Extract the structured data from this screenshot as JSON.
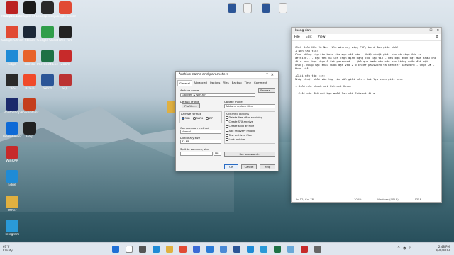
{
  "desktop_icons": [
    {
      "label": "Recycle Bin",
      "color": "#3d6fa8"
    },
    {
      "label": "League of Legends",
      "color": "#1a1a1a"
    },
    {
      "label": "Kaspersky",
      "color": "#2a2a2a"
    },
    {
      "label": "Google Chrome",
      "color": "#e14a34"
    },
    {
      "label": "Google Chrome",
      "color": "#e14a34"
    },
    {
      "label": "Steam",
      "color": "#1b2838"
    },
    {
      "label": "Google Sheets",
      "color": "#2f9e4a"
    },
    {
      "label": "Wild Rift",
      "color": "#222"
    },
    {
      "label": "Edge",
      "color": "#1f8bd6"
    },
    {
      "label": "Firefox",
      "color": "#e8632a"
    },
    {
      "label": "Microsoft Excel",
      "color": "#1e7145"
    },
    {
      "label": "Zoom",
      "color": "#c72a2a"
    },
    {
      "label": "OBS",
      "color": "#2a2a2a"
    },
    {
      "label": "Brave",
      "color": "#f04a2a"
    },
    {
      "label": "Word",
      "color": "#2b5597"
    },
    {
      "label": "SQL",
      "color": "#b33"
    },
    {
      "label": "Photoshop",
      "color": "#1b2a6b"
    },
    {
      "label": "PowerPoint",
      "color": "#c43e1c"
    },
    {
      "label": "TeamViewer",
      "color": "#0e6ad6"
    },
    {
      "label": "Help",
      "color": "#222"
    },
    {
      "label": "WinRAR",
      "color": "#c72a2a"
    },
    {
      "label": "Edge",
      "color": "#1f8bd6"
    },
    {
      "label": "Other",
      "color": "#e0b040"
    },
    {
      "label": "Telegram",
      "color": "#2a9ad8"
    },
    {
      "label": "NF",
      "color": "#e0b040"
    },
    {
      "label": "Mobile Gamer",
      "color": "#b22"
    }
  ],
  "top_files": [
    {
      "label": "Word doc",
      "color": "#2b5597"
    },
    {
      "label": "Image file",
      "color": "#f2f2f2"
    },
    {
      "label": "Word doc",
      "color": "#2b5597"
    },
    {
      "label": "Text file",
      "color": "#f2f2f2"
    }
  ],
  "winrar": {
    "title": "Archive name and parameters",
    "tabs": [
      "General",
      "Advanced",
      "Options",
      "Files",
      "Backup",
      "Time",
      "Comment"
    ],
    "archive_name_label": "Archive name",
    "archive_name_value": "Giai Nen & Nen.rar",
    "browse_label": "Browse...",
    "default_profile_label": "Default Profile",
    "profiles_label": "Profiles...",
    "update_mode_label": "Update mode",
    "update_mode_value": "Add and replace files",
    "archive_format_label": "Archive format",
    "formats": [
      "RAR",
      "RAR4",
      "ZIP"
    ],
    "compression_label": "Compression method",
    "compression_value": "Normal",
    "dict_label": "Dictionary size",
    "dict_value": "32 MB",
    "split_label": "Split to volumes, size",
    "split_unit": "MB",
    "options_label": "Archiving options",
    "options": [
      {
        "label": "Delete files after archiving",
        "on": false
      },
      {
        "label": "Create SFX archive",
        "on": false
      },
      {
        "label": "Create solid archive",
        "on": false
      },
      {
        "label": "Add recovery record",
        "on": false
      },
      {
        "label": "Test archived files",
        "on": false
      },
      {
        "label": "Lock archive",
        "on": false
      }
    ],
    "set_password_label": "Set password...",
    "ok_label": "OK",
    "cancel_label": "Cancel",
    "help_label": "Help"
  },
  "notepad": {
    "title": "Huong dan",
    "menu": [
      "File",
      "Edit",
      "View"
    ],
    "lines": [
      "Cách Giải Nén Và Nén file winrar, zip, PDF, Word đơn giản nhất",
      "+ Nén tập tin:",
      "Chọn những tập tin hoặc thư mục cần nén - Nhấp chuột phải vào và chọn Add to archive.. - Đặt tên và lựa chọn định dạng cho tập tin - Nếu bạn muốn đặt mật khẩu cho file nén, bạn chọn ô Set password... (bỏ qua bước này nếu bạn không muốn đặt mật khẩu)- Nhập mật khẩu muốn đặt vào 2 ô Enter password và Reenter password - Chọn OK - Hoàn tất.",
      "",
      "+Giải nén tập tin:",
      "Nhấp chuột phải vào tập tin cần giải nén - Hai lựa chọn giải nén:",
      "",
      "- Giải nén nhanh với Extract Here.",
      "",
      "- Giải nén đến nơi bạn muốn lưu với Extract file…"
    ],
    "status_pos": "Ln 52, Col 78",
    "status_zoom": "100%",
    "status_eol": "Windows (CRLF)",
    "status_enc": "UTF-8"
  },
  "taskbar": {
    "temp": "67°F",
    "condition": "Cloudy",
    "time": "2:48 PM",
    "date": "3/30/2023",
    "apps": [
      {
        "name": "start",
        "color": "#1f6fd6"
      },
      {
        "name": "search",
        "color": "#ffffff"
      },
      {
        "name": "task-view",
        "color": "#555555"
      },
      {
        "name": "edge",
        "color": "#1f8bd6"
      },
      {
        "name": "file-explorer",
        "color": "#e0b040"
      },
      {
        "name": "chrome",
        "color": "#e14a34"
      },
      {
        "name": "store",
        "color": "#3a6ad6"
      },
      {
        "name": "mail",
        "color": "#2a7ad6"
      },
      {
        "name": "photos",
        "color": "#4a8ad6"
      },
      {
        "name": "word",
        "color": "#2b5597"
      },
      {
        "name": "zalo",
        "color": "#1f8bd6"
      },
      {
        "name": "telegram",
        "color": "#2a9ad8"
      },
      {
        "name": "excel",
        "color": "#1e7145"
      },
      {
        "name": "notepad",
        "color": "#6aa8d8"
      },
      {
        "name": "winrar",
        "color": "#c72a2a"
      },
      {
        "name": "settings",
        "color": "#666666"
      }
    ]
  }
}
